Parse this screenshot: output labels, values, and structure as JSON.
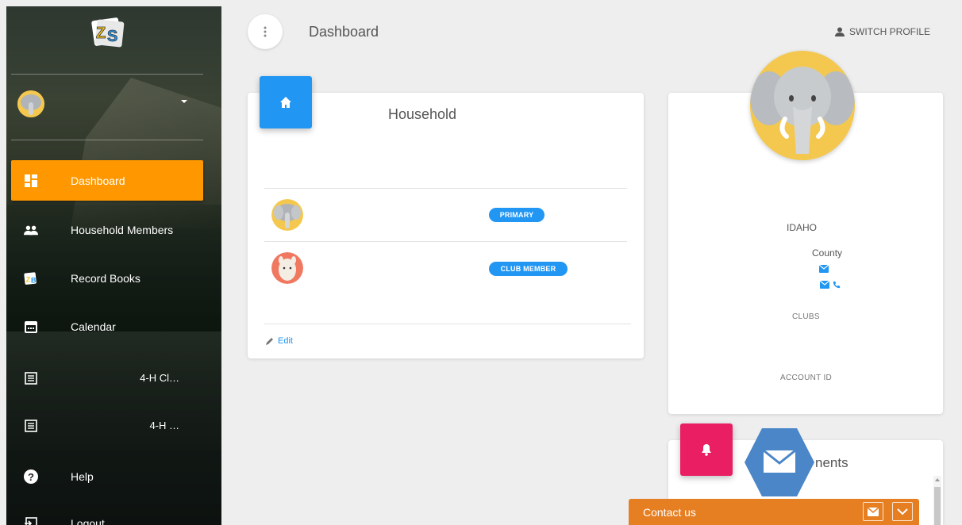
{
  "app": {
    "logo_text": "ZS"
  },
  "header": {
    "page_title": "Dashboard",
    "switch_profile": "SWITCH PROFILE"
  },
  "sidebar": {
    "items": [
      {
        "label": "Dashboard",
        "icon": "dashboard-icon",
        "active": true
      },
      {
        "label": "Household Members",
        "icon": "people-icon"
      },
      {
        "label": "Record Books",
        "icon": "record-books-icon"
      },
      {
        "label": "Calendar",
        "icon": "calendar-icon"
      },
      {
        "label": "4-H Cl…",
        "icon": "list-icon"
      },
      {
        "label": "4-H …",
        "icon": "list-icon"
      },
      {
        "label": "Help",
        "icon": "help-icon"
      },
      {
        "label": "Logout",
        "icon": "logout-icon"
      }
    ]
  },
  "household": {
    "title": "Household",
    "members": [
      {
        "badge": "PRIMARY"
      },
      {
        "badge": "CLUB MEMBER"
      }
    ],
    "edit_label": "Edit"
  },
  "profile_card": {
    "state": "IDAHO",
    "county": "County",
    "clubs_label": "CLUBS",
    "account_id_label": "ACCOUNT ID"
  },
  "announcements": {
    "title_partial": "nents"
  },
  "contact": {
    "label": "Contact us"
  },
  "colors": {
    "active_nav": "#ff9800",
    "primary_blue": "#2196f3",
    "pink_tile": "#e91e63",
    "contact_orange": "#e67e22",
    "hex_blue": "#4a86c8"
  }
}
